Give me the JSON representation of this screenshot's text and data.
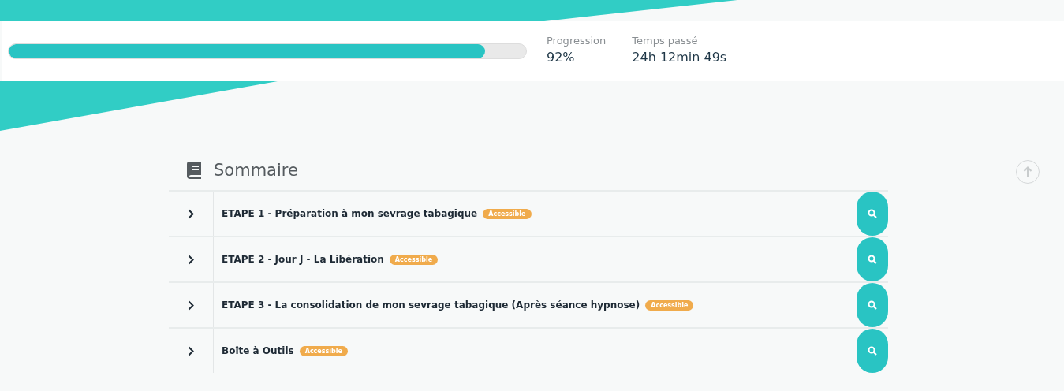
{
  "progress": {
    "level": 0.92,
    "stats": [
      {
        "label": "Progression",
        "value": "92%"
      },
      {
        "label": "Temps passé",
        "value": "24h 12min 49s"
      }
    ]
  },
  "summary": {
    "title": "Sommaire",
    "rows": [
      {
        "title": "ETAPE 1 - Préparation à mon sevrage tabagique",
        "badge": "Accessible"
      },
      {
        "title": "ETAPE 2 - Jour J - La Libération",
        "badge": "Accessible"
      },
      {
        "title": "ETAPE 3 - La consolidation de mon sevrage tabagique (Après séance hypnose)",
        "badge": "Accessible"
      },
      {
        "title": "Boîte à Outils",
        "badge": "Accessible"
      }
    ]
  }
}
